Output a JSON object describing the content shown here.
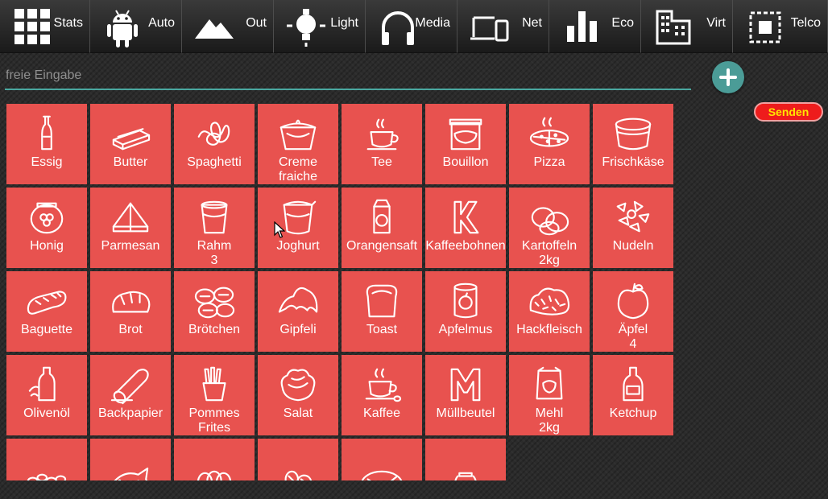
{
  "nav": [
    {
      "label": "Stats",
      "icon": "grid-icon"
    },
    {
      "label": "Auto",
      "icon": "android-icon"
    },
    {
      "label": "Out",
      "icon": "mountains-icon"
    },
    {
      "label": "Light",
      "icon": "lightbulb-icon"
    },
    {
      "label": "Media",
      "icon": "headphones-icon"
    },
    {
      "label": "Net",
      "icon": "devices-icon"
    },
    {
      "label": "Eco",
      "icon": "bar-chart-icon"
    },
    {
      "label": "Virt",
      "icon": "building-icon"
    },
    {
      "label": "Telco",
      "icon": "chip-icon"
    }
  ],
  "input": {
    "placeholder": "freie Eingabe",
    "value": ""
  },
  "send_label": "Senden",
  "items": [
    {
      "label": "Essig",
      "icon": "vinegar-bottle-icon"
    },
    {
      "label": "Butter",
      "icon": "butter-icon"
    },
    {
      "label": "Spaghetti",
      "icon": "spaghetti-icon"
    },
    {
      "label": "Creme\nfraiche",
      "icon": "creme-fraiche-cup-icon"
    },
    {
      "label": "Tee",
      "icon": "teacup-icon"
    },
    {
      "label": "Bouillon",
      "icon": "bouillon-jar-icon"
    },
    {
      "label": "Pizza",
      "icon": "pizza-icon"
    },
    {
      "label": "Frischkäse",
      "icon": "cream-cheese-tub-icon"
    },
    {
      "label": "Honig",
      "icon": "honey-jar-icon"
    },
    {
      "label": "Parmesan",
      "icon": "parmesan-icon"
    },
    {
      "label": "Rahm\n3",
      "icon": "cream-cup-icon"
    },
    {
      "label": "Joghurt",
      "icon": "yogurt-cup-icon"
    },
    {
      "label": "Orangensaft",
      "icon": "juice-carton-icon"
    },
    {
      "label": "Kaffeebohnen",
      "icon": "coffee-beans-k-icon"
    },
    {
      "label": "Kartoffeln\n2kg",
      "icon": "potatoes-icon"
    },
    {
      "label": "Nudeln",
      "icon": "pasta-icon"
    },
    {
      "label": "Baguette",
      "icon": "baguette-icon"
    },
    {
      "label": "Brot",
      "icon": "bread-loaf-icon"
    },
    {
      "label": "Brötchen",
      "icon": "bread-rolls-icon"
    },
    {
      "label": "Gipfeli",
      "icon": "croissant-icon"
    },
    {
      "label": "Toast",
      "icon": "toast-icon"
    },
    {
      "label": "Apfelmus",
      "icon": "applesauce-can-icon"
    },
    {
      "label": "Hackfleisch",
      "icon": "minced-meat-icon"
    },
    {
      "label": "Äpfel\n4",
      "icon": "apple-icon"
    },
    {
      "label": "Olivenöl",
      "icon": "olive-oil-icon"
    },
    {
      "label": "Backpapier",
      "icon": "baking-paper-roll-icon"
    },
    {
      "label": "Pommes\nFrites",
      "icon": "french-fries-icon"
    },
    {
      "label": "Salat",
      "icon": "lettuce-icon"
    },
    {
      "label": "Kaffee",
      "icon": "coffee-cup-icon"
    },
    {
      "label": "Müllbeutel",
      "icon": "trash-bag-m-icon"
    },
    {
      "label": "Mehl\n2kg",
      "icon": "flour-bag-icon"
    },
    {
      "label": "Ketchup",
      "icon": "ketchup-bottle-icon"
    },
    {
      "label": "",
      "icon": "nuts-icon"
    },
    {
      "label": "",
      "icon": "fish-icon"
    },
    {
      "label": "",
      "icon": "eggs-icon"
    },
    {
      "label": "",
      "icon": "sausages-icon"
    },
    {
      "label": "",
      "icon": "cheese-wheel-icon"
    },
    {
      "label": "",
      "icon": "jar-icon"
    }
  ],
  "colors": {
    "tile": "#e8524f",
    "accent": "#4b9c97",
    "send": "#ee1c1c",
    "send_text": "#ffe600"
  }
}
